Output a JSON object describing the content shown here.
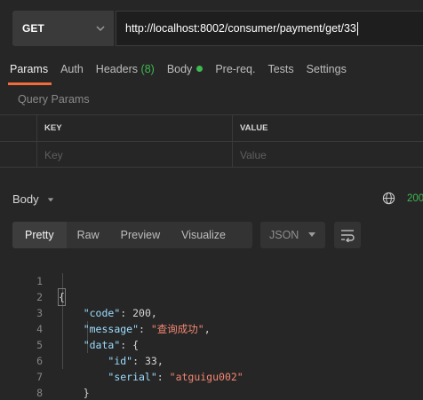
{
  "request": {
    "method": "GET",
    "url": "http://localhost:8002/consumer/payment/get/33"
  },
  "tabs": [
    {
      "label": "Params",
      "active": true
    },
    {
      "label": "Auth"
    },
    {
      "label": "Headers",
      "count": "(8)"
    },
    {
      "label": "Body",
      "indicator": "green-dot"
    },
    {
      "label": "Pre-req."
    },
    {
      "label": "Tests"
    },
    {
      "label": "Settings"
    }
  ],
  "query_params": {
    "title": "Query Params",
    "headers": [
      "KEY",
      "VALUE"
    ],
    "placeholders": [
      "Key",
      "Value"
    ]
  },
  "response": {
    "body_label": "Body",
    "status_text": "200",
    "view_tabs": [
      "Pretty",
      "Raw",
      "Preview",
      "Visualize"
    ],
    "format": "JSON",
    "icons": {
      "globe": "globe-icon",
      "wrap": "wrap-lines-icon",
      "dropdown": "chevron-down-icon"
    },
    "lines": [
      {
        "n": "1",
        "text": "{"
      },
      {
        "n": "2",
        "text": "    \"code\": 200,"
      },
      {
        "n": "3",
        "text": "    \"message\": \"查询成功\","
      },
      {
        "n": "4",
        "text": "    \"data\": {"
      },
      {
        "n": "5",
        "text": "        \"id\": 33,"
      },
      {
        "n": "6",
        "text": "        \"serial\": \"atguigu002\""
      },
      {
        "n": "7",
        "text": "    }"
      },
      {
        "n": "8",
        "text": "}"
      }
    ],
    "json": {
      "code_key": "\"code\"",
      "code_val": "200",
      "message_key": "\"message\"",
      "message_val": "\"查询成功\"",
      "data_key": "\"data\"",
      "id_key": "\"id\"",
      "id_val": "33",
      "serial_key": "\"serial\"",
      "serial_val": "\"atguigu002\""
    }
  },
  "colors": {
    "accent": "#f26b3a",
    "success": "#3fb950",
    "key": "#9cdcfe",
    "string": "#f48771"
  }
}
